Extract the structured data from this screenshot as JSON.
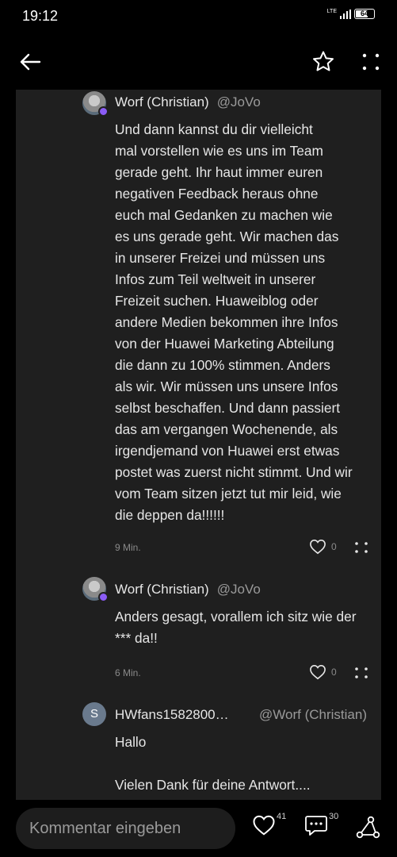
{
  "status": {
    "time": "19:12",
    "network": "LTE",
    "battery": "64"
  },
  "comments": [
    {
      "author": "Worf (Christian)",
      "handle": "@JoVo",
      "text": "Und dann kannst du dir vielleicht\nmal vorstellen wie es uns im Team\ngerade geht. Ihr haut immer euren\nnegativen Feedback heraus ohne\neuch mal Gedanken zu machen wie\nes uns gerade geht. Wir machen das\nin unserer Freizei und müssen uns\nInfos zum Teil weltweit in unserer\nFreizeit suchen. Huaweiblog oder\nandere Medien bekommen ihre Infos\nvon der Huawei Marketing Abteilung\ndie dann zu 100% stimmen. Anders\nals wir. Wir müssen uns unsere Infos\nselbst beschaffen. Und dann passiert\ndas am vergangen Wochenende, als\nirgendjemand von Huawei erst etwas\npostet was zuerst nicht stimmt. Und wir\nvom Team sitzen jetzt tut mir leid, wie\ndie deppen da!!!!!!",
      "time": "9 Min.",
      "likes": "0"
    },
    {
      "author": "Worf (Christian)",
      "handle": "@JoVo",
      "text": "Anders gesagt, vorallem ich sitz wie der\n*** da!!",
      "time": "6 Min.",
      "likes": "0"
    },
    {
      "avatar_letter": "S",
      "author": "HWfans1582800…",
      "reply_to": "@Worf (Christian)",
      "text": "Hallo\n\nVielen Dank für deine Antwort...."
    }
  ],
  "bottom": {
    "placeholder": "Kommentar eingeben",
    "likes_count": "41",
    "comments_count": "30"
  },
  "icons": [
    "back-arrow-icon",
    "star-icon",
    "more-vertical-icon",
    "heart-icon",
    "comment-icon",
    "share-icon"
  ],
  "colors": {
    "background": "#000000",
    "panel": "#1f1f1f",
    "text": "#e6e6e6",
    "muted": "#9a9a9a",
    "badge": "#8b5cf6"
  }
}
